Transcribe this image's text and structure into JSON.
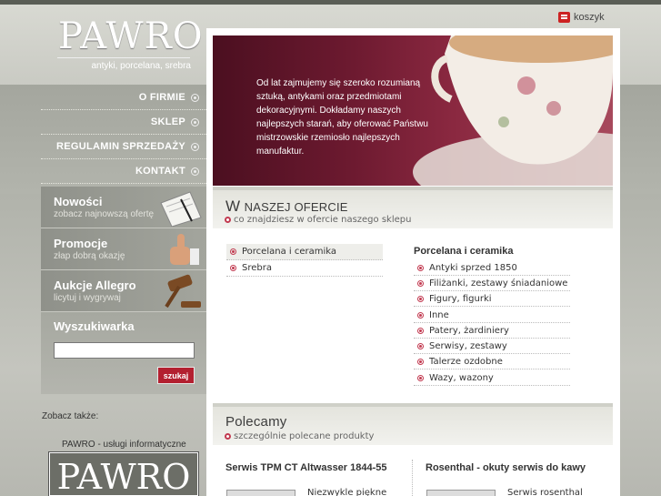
{
  "header": {
    "logo_text": "PAWRO",
    "tagline": "antyki, porcelana, srebra",
    "cart_label": "koszyk"
  },
  "nav": {
    "items": [
      {
        "label": "O firmie"
      },
      {
        "label": "Sklep"
      },
      {
        "label": "Regulamin sprzedaży"
      },
      {
        "label": "Kontakt"
      }
    ]
  },
  "promos": [
    {
      "title": "Nowości",
      "subtitle": "zobacz najnowszą ofertę"
    },
    {
      "title": "Promocje",
      "subtitle": "złap dobrą okazję"
    },
    {
      "title": "Aukcje Allegro",
      "subtitle": "licytuj i wygrywaj"
    }
  ],
  "search": {
    "title": "Wyszukiwarka",
    "input_value": "",
    "button_label": "szukaj"
  },
  "footer_left": {
    "see_also": "Zobacz także:",
    "link_label": "PAWRO - usługi informatyczne",
    "banner_text": "PAWRO"
  },
  "hero": {
    "text": "Od lat zajmujemy się szeroko rozumianą sztuką, antykami oraz przedmiotami dekoracyjnymi. Dokładamy naszych najlepszych starań, aby oferować Państwu mistrzowskie rzemiosło najlepszych manufaktur."
  },
  "offer": {
    "title_first": "W",
    "title_rest": "naszej ofercie",
    "subtitle": "co znajdziesz w ofercie naszego sklepu",
    "left_categories": [
      {
        "label": "Porcelana i ceramika",
        "selected": true
      },
      {
        "label": "Srebra",
        "selected": false
      }
    ],
    "right_heading": "Porcelana i ceramika",
    "right_items": [
      "Antyki sprzed 1850",
      "Filiżanki, zestawy śniadaniowe",
      "Figury, figurki",
      "Inne",
      "Patery, żardiniery",
      "Serwisy, zestawy",
      "Talerze ozdobne",
      "Wazy, wazony"
    ]
  },
  "recommended": {
    "title": "Polecamy",
    "subtitle": "szczególnie polecane produkty",
    "products": [
      {
        "title": "Serwis TPM CT Altwasser 1844-55",
        "desc": "Niezwykle piękne"
      },
      {
        "title": "Rosenthal - okuty serwis do kawy",
        "desc": "Serwis rosenthal"
      }
    ]
  },
  "colors": {
    "accent": "#b32030",
    "hero_dark": "#4b0f20",
    "sidebar": "#a6a8a0"
  }
}
